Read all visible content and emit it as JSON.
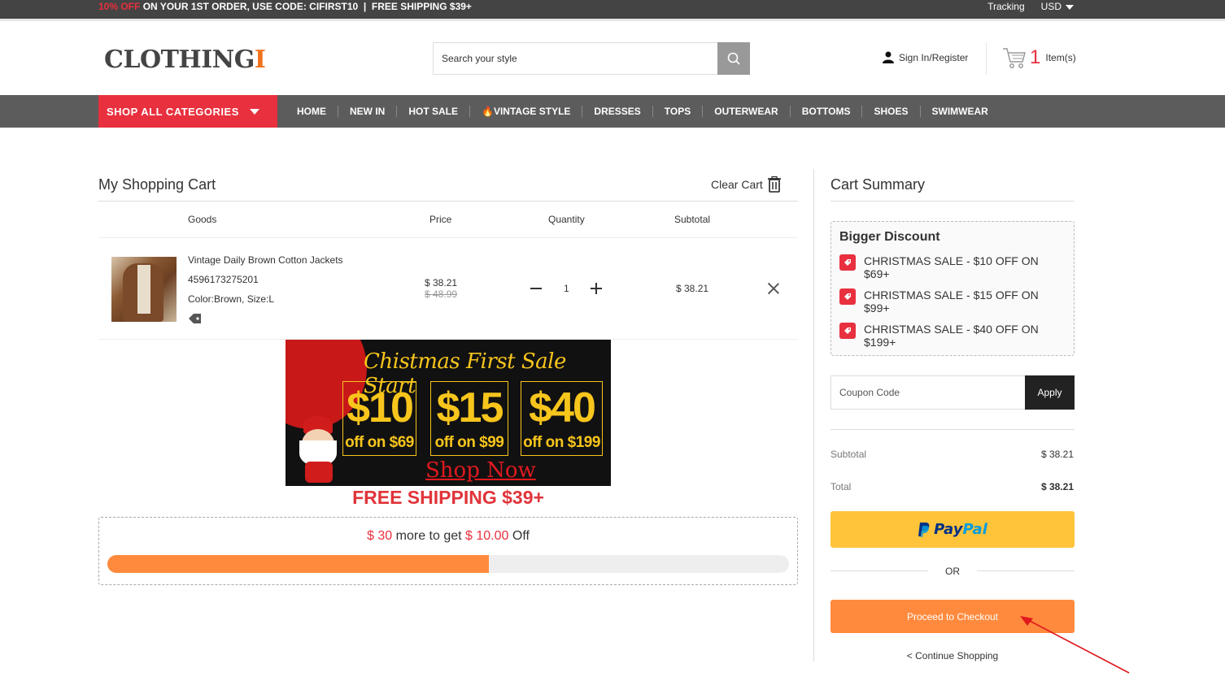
{
  "topbar": {
    "promo_highlight": "10% OFF",
    "promo_text": " ON YOUR 1ST ORDER, USE CODE: CIFIRST10  |  FREE SHIPPING $39+",
    "tracking": "Tracking",
    "currency": "USD"
  },
  "header": {
    "logo_main": "CLOTHING",
    "logo_accent": "I",
    "search_placeholder": "Search your style",
    "signin": "Sign In/Register",
    "cart_count": "1",
    "cart_label": "Item(s)"
  },
  "nav": {
    "shop_all": "SHOP ALL CATEGORIES",
    "links": [
      "HOME",
      "NEW IN",
      "HOT SALE",
      "🔥VINTAGE STYLE",
      "DRESSES",
      "TOPS",
      "OUTERWEAR",
      "BOTTOMS",
      "SHOES",
      "SWIMWEAR"
    ]
  },
  "cart": {
    "title": "My Shopping Cart",
    "clear": "Clear Cart",
    "columns": {
      "goods": "Goods",
      "price": "Price",
      "quantity": "Quantity",
      "subtotal": "Subtotal"
    },
    "item": {
      "name": "Vintage Daily Brown Cotton Jackets",
      "sku": "4596173275201",
      "attrs": "Color:Brown, Size:L",
      "price": "$ 38.21",
      "old_price": "$ 48.99",
      "quantity": "1",
      "subtotal": "$ 38.21"
    }
  },
  "banner": {
    "headline": "Chistmas First Sale Start",
    "offers": [
      {
        "amount": "$10",
        "text": "off on $69"
      },
      {
        "amount": "$15",
        "text": "off on $99"
      },
      {
        "amount": "$40",
        "text": "off on $199"
      }
    ],
    "cta": "Shop Now"
  },
  "free_shipping": "FREE SHIPPING $39+",
  "progress": {
    "more_amount": "$ 30",
    "text_mid": " more to get ",
    "discount_amount": "$ 10.00",
    "text_end": " Off",
    "fill_fraction": 0.56
  },
  "summary": {
    "title": "Cart Summary",
    "discount_title": "Bigger Discount",
    "discounts": [
      "CHRISTMAS SALE - $10 OFF ON $69+",
      "CHRISTMAS SALE - $15 OFF ON $99+",
      "CHRISTMAS SALE - $40 OFF ON $199+"
    ],
    "coupon_placeholder": "Coupon Code",
    "apply": "Apply",
    "subtotal_label": "Subtotal",
    "subtotal_value": "$ 38.21",
    "total_label": "Total",
    "total_value": "$ 38.21",
    "paypal_pay": "Pay",
    "paypal_pal": "Pal",
    "or": "OR",
    "checkout": "Proceed to Checkout",
    "continue": "< Continue Shopping"
  },
  "colors": {
    "accent_red": "#e8303e",
    "checkout_orange": "#ff8a3d",
    "paypal_yellow": "#ffc439"
  }
}
